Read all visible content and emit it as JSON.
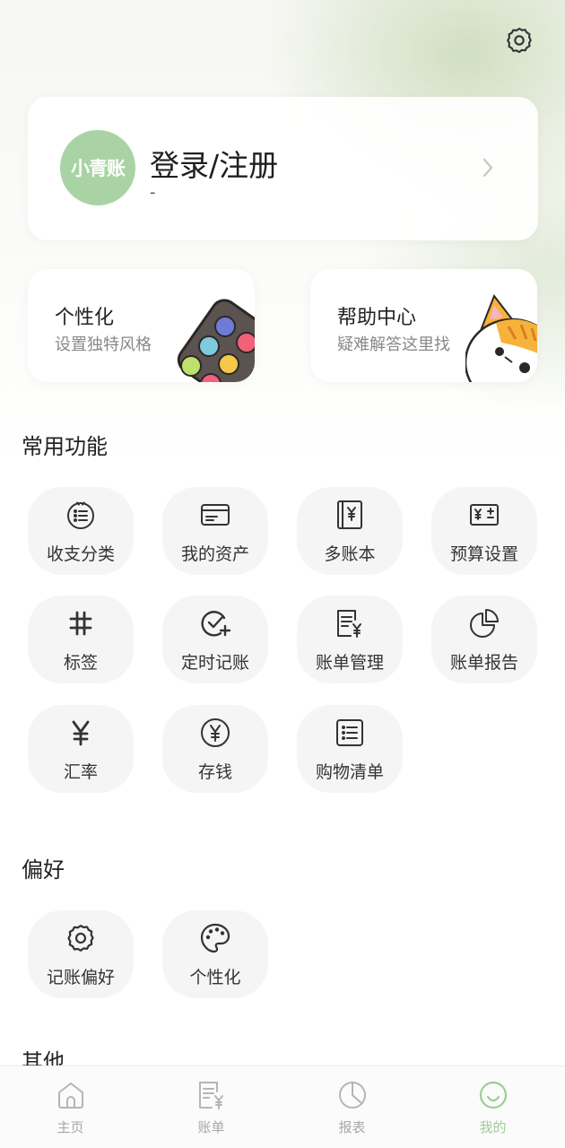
{
  "header": {
    "settings_icon": "gear-icon"
  },
  "login": {
    "avatar_text": "小青账",
    "title": "登录/注册",
    "subtitle": "-",
    "avatar_color": "#a9d3a5"
  },
  "feature_cards": [
    {
      "title": "个性化",
      "subtitle": "设置独特风格",
      "art": "palette-art"
    },
    {
      "title": "帮助中心",
      "subtitle": "疑难解答这里找",
      "art": "cat-art"
    }
  ],
  "sections": {
    "common_title": "常用功能",
    "prefs_title": "偏好",
    "other_title": "其他"
  },
  "common_functions": [
    {
      "label": "收支分类",
      "icon": "category-icon"
    },
    {
      "label": "我的资产",
      "icon": "card-icon"
    },
    {
      "label": "多账本",
      "icon": "ledger-book-icon"
    },
    {
      "label": "预算设置",
      "icon": "budget-icon"
    },
    {
      "label": "标签",
      "icon": "hashtag-icon"
    },
    {
      "label": "定时记账",
      "icon": "timed-check-icon"
    },
    {
      "label": "账单管理",
      "icon": "bill-manage-icon"
    },
    {
      "label": "账单报告",
      "icon": "pie-report-icon"
    },
    {
      "label": "汇率",
      "icon": "yen-icon"
    },
    {
      "label": "存钱",
      "icon": "coin-icon"
    },
    {
      "label": "购物清单",
      "icon": "list-icon"
    }
  ],
  "preferences": [
    {
      "label": "记账偏好",
      "icon": "gear-icon"
    },
    {
      "label": "个性化",
      "icon": "palette-icon"
    }
  ],
  "bottom_nav": [
    {
      "label": "主页",
      "icon": "home-icon",
      "active": false
    },
    {
      "label": "账单",
      "icon": "bill-icon",
      "active": false
    },
    {
      "label": "报表",
      "icon": "chart-icon",
      "active": false
    },
    {
      "label": "我的",
      "icon": "smile-icon",
      "active": true
    }
  ],
  "colors": {
    "accent": "#9ccf96",
    "tile_bg": "#f5f5f5"
  }
}
